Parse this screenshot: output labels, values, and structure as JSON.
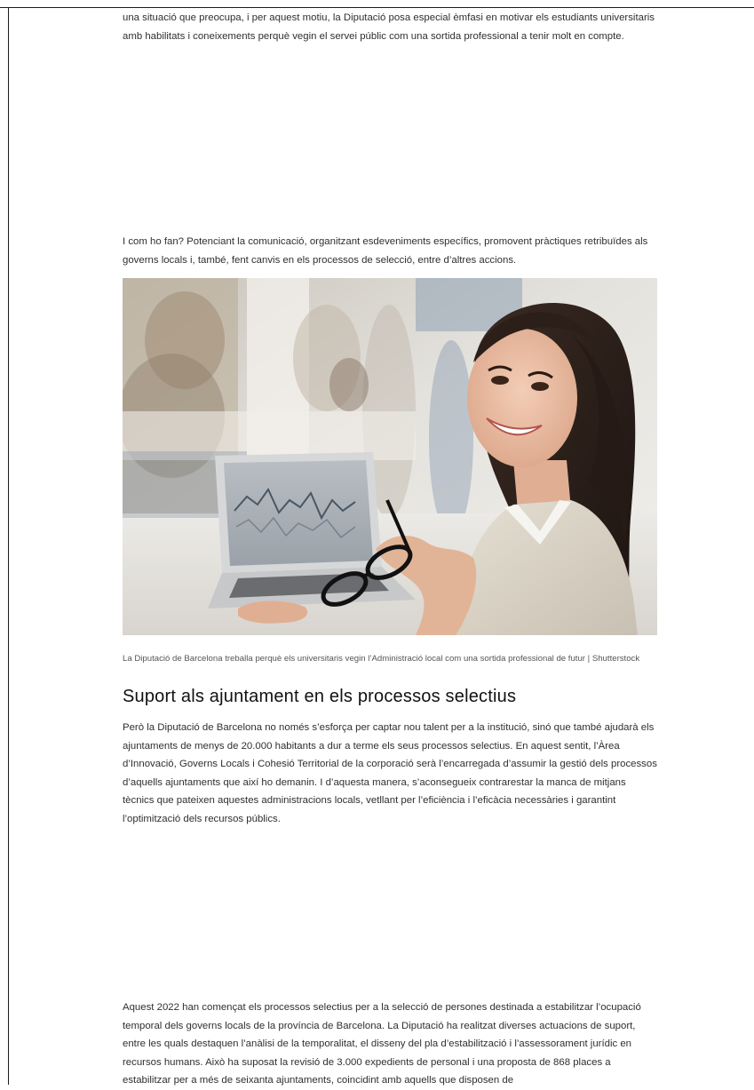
{
  "article": {
    "paragraph_intro": "una situació que preocupa, i per aquest motiu, la Diputació posa especial èmfasi en motivar els estudiants universitaris amb habilitats i coneixements perquè vegin el servei públic com una sortida professional a tenir molt en compte.",
    "paragraph_how": "I com ho fan? Potenciant la comunicació, organitzant esdeveniments específics, promovent pràctiques retribuïdes als governs locals i, també, fent canvis en els processos de selecció, entre d’altres accions.",
    "image_caption": "La Diputació de Barcelona treballa perquè els universitaris vegin l’Administració local com una sortida professional de futur | Shutterstock",
    "section_heading": "Suport als ajuntament en els processos selectius",
    "paragraph_support": "Però la Diputació de Barcelona no només s’esforça per captar nou talent per a la institució, sinó que també ajudarà els ajuntaments de menys de 20.000 habitants a dur a terme els seus processos selectius. En aquest sentit, l’Àrea d’Innovació, Governs Locals i Cohesió Territorial de la corporació serà l’encarregada d’assumir la gestió dels processos d’aquells ajuntaments que així ho demanin. I d’aquesta manera, s’aconsegueix contrarestar la manca de mitjans tècnics que pateixen aquestes administracions locals, vetllant per l’eficiència i l’eficàcia necessàries i garantint l’optimització dels recursos públics.",
    "paragraph_2022": "Aquest 2022 han començat els processos selectius per a la selecció de persones destinada a estabilitzar l’ocupació temporal dels governs locals de la província de Barcelona. La Diputació ha realitzat diverses actuacions de suport, entre les quals destaquen l’anàlisi de la temporalitat, el disseny del pla d’estabilització i l’assessorament jurídic en recursos humans. Això ha suposat la revisió de 3.000 expedients de personal i una proposta de 868 places a estabilitzar per a més de seixanta ajuntaments, coincidint amb aquells que disposen de"
  },
  "colors": {
    "text": "#2f2f2f",
    "heading": "#111111",
    "caption": "#555555",
    "background": "#ffffff"
  }
}
